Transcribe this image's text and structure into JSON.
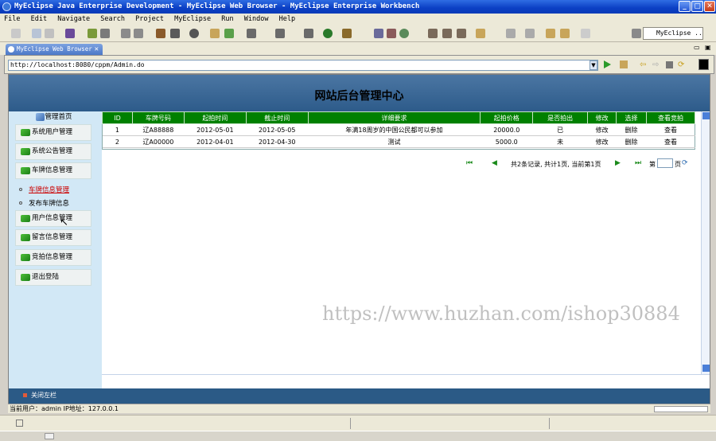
{
  "window": {
    "title": "MyEclipse Java Enterprise Development - MyEclipse Web Browser - MyEclipse Enterprise Workbench"
  },
  "menu": [
    "File",
    "Edit",
    "Navigate",
    "Search",
    "Project",
    "MyEclipse",
    "Run",
    "Window",
    "Help"
  ],
  "toolbar": {
    "perspective": "MyEclipse ..."
  },
  "editor_tab": {
    "label": "MyEclipse Web Browser"
  },
  "address": {
    "url": "http://localhost:8080/cppm/Admin.do"
  },
  "page": {
    "banner_title": "网站后台管理中心",
    "sidebar": {
      "header": "管理首页",
      "items": [
        {
          "label": "系统用户管理"
        },
        {
          "label": "系统公告管理"
        },
        {
          "label": "车牌信息管理"
        }
      ],
      "sublinks": [
        {
          "label": "车牌信息管理",
          "color": "#cc0000"
        },
        {
          "label": "发布车牌信息",
          "color": "#000000"
        }
      ],
      "items2": [
        {
          "label": "用户信息管理"
        },
        {
          "label": "留言信息管理"
        },
        {
          "label": "竞拍信息管理"
        },
        {
          "label": "退出登陆"
        }
      ]
    },
    "table": {
      "headers": [
        "ID",
        "车牌号码",
        "起拍时间",
        "截止时间",
        "详细要求",
        "起拍价格",
        "是否拍出",
        "修改",
        "选择",
        "查看竞拍"
      ],
      "rows": [
        [
          "1",
          "辽A88888",
          "2012-05-01",
          "2012-05-05",
          "年满18周岁的中国公民都可以参加",
          "20000.0",
          "已",
          "修改",
          "删除",
          "查看"
        ],
        [
          "2",
          "辽A00000",
          "2012-04-01",
          "2012-04-30",
          "测试",
          "5000.0",
          "未",
          "修改",
          "删除",
          "查看"
        ]
      ]
    },
    "pager": {
      "summary": "共2条记录, 共计1页, 当前第1页",
      "page_label": "第",
      "page_suffix": "页"
    },
    "footer": {
      "label": "关闭左栏"
    }
  },
  "status": {
    "current_user": "当前用户：admin  IP地址：127.0.0.1"
  },
  "watermark": "https://www.huzhan.com/ishop30884",
  "colors": {
    "header_green": "#008000",
    "banner_blue": "#2d5b8a",
    "sidebar_bg": "#d2e8f6"
  }
}
